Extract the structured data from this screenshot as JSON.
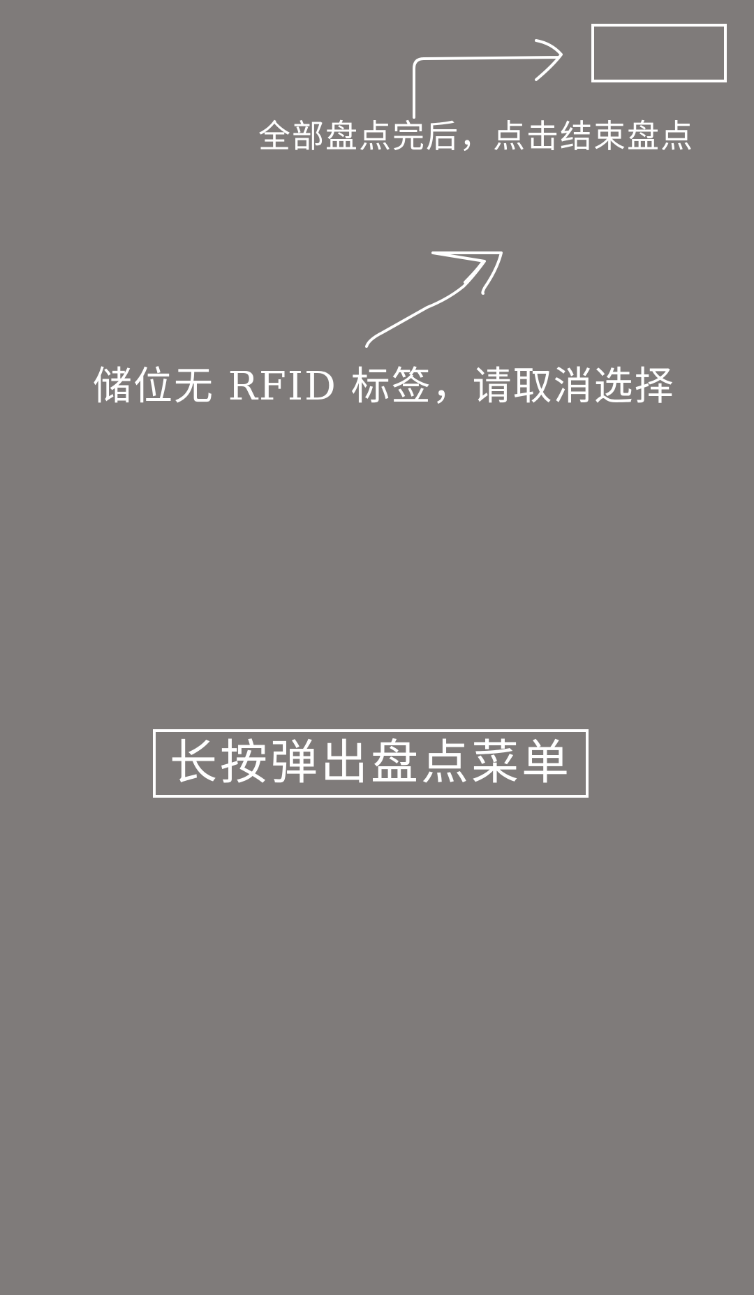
{
  "hints": {
    "end_inventory": "全部盘点完后，点击结束盘点",
    "no_rfid": "储位无 RFID 标签，请取消选择",
    "long_press_menu": "长按弹出盘点菜单"
  },
  "colors": {
    "background": "#7f7b7a",
    "annotation": "#ffffff"
  },
  "icons": {
    "end_arrow": "arrow-right-hooked-icon",
    "rfid_arrow": "arrow-up-right-icon"
  }
}
